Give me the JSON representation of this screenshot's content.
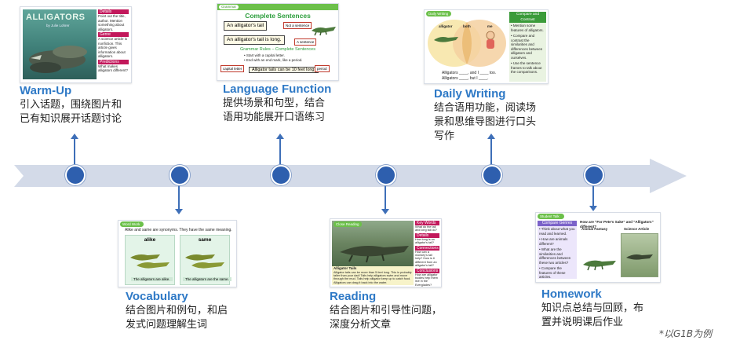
{
  "note": "*以G1B为例",
  "stages": {
    "warmup": {
      "title": "Warm-Up",
      "desc_line1": "引入话题，围绕图片和",
      "desc_line2": "已有知识展开话题讨论",
      "book_title": "ALLIGATORS",
      "book_author": "by Julie Lohrer",
      "side": [
        {
          "tag": "Details",
          "text": "Point out the title, author. Mention something about alligators."
        },
        {
          "tag": "Genre",
          "text": "A science article is nonfiction. This article gives information about alligators."
        },
        {
          "tag": "Predictions",
          "text": "What makes alligators different?"
        }
      ]
    },
    "vocabulary": {
      "title": "Vocabulary",
      "desc_line1": "结合图片和例句，和启",
      "desc_line2": "发式问题理解生词",
      "pill": "Word Work",
      "sentence": "Alike and same are synonyms. They have the same meaning.",
      "card1_word": "alike",
      "card2_word": "same",
      "caption": "The alligators are alike.",
      "caption2": "The alligators are the same."
    },
    "language": {
      "title": "Language Function",
      "desc_line1": "提供场景和句型，结合",
      "desc_line2": "语用功能展开口语练习",
      "pill": "Grammar",
      "heading": "Complete Sentences",
      "s1": "An alligator's tail",
      "s1_tag": "Not a sentence",
      "s2": "An alligator's tail is long.",
      "s2_tag": "A sentence",
      "rules_title": "Grammar Rules – Complete Sentences",
      "rule1": "Start with a capital letter.",
      "rule2": "End with an end mark, like a period.",
      "ex_left": "capital letter",
      "ex_sentence": "Alligator tails can be 10 feet long.",
      "ex_right": "period"
    },
    "reading": {
      "title": "Reading",
      "desc_line1": "结合图片和引导性问题，",
      "desc_line2": "深度分析文章",
      "pill": "Close Reading",
      "passage_title": "Alligator Tails",
      "passage": "Alligator tails can be more than 5 feet long. This is probably taller than your dad! Tails help alligators swim and move through the mud. Tails help alligator keep up to catch food. Alligators can drag it back into the water.",
      "side": [
        {
          "tag": "Key Words",
          "text": "What do the tail and long tail do?"
        },
        {
          "tag": "Details",
          "text": "How long is an alligator's tail?"
        },
        {
          "tag": "Connections",
          "text": "How can a monkey's tail help? How is it different from an alligator's tail?"
        },
        {
          "tag": "Conclusions",
          "text": "How are alligator bodies help them live in the Everglades?"
        }
      ]
    },
    "writing": {
      "title": "Daily Writing",
      "desc_line1": "结合语用功能，阅读场",
      "desc_line2": "景和思维导图进行口头",
      "desc_line3": "写作",
      "pill": "Daily Writing",
      "left_label": "alligator",
      "mid_label": "both",
      "right_label": "me",
      "frame1": "Alligators ____, and I ____ too.",
      "frame2": "Alligators ____, but I ____.",
      "panel_title": "Compare and Contrast",
      "panel_items": [
        "Mention some features of alligators.",
        "Compare and contrast the similarities and differences between alligators and ourselves.",
        "Use the sentence frames to talk about the comparisons."
      ]
    },
    "homework": {
      "title": "Homework",
      "desc_line1": "知识点总结与回顾，布",
      "desc_line2": "置并说明课后作业",
      "pill": "Student Talk",
      "question": "How are \"For Pete's Sake\" and \"Alligators\" different?",
      "panel_title": "Compare Genres",
      "panel_items": [
        "Think about what you read and learned.",
        "How are animals different?",
        "What are the similarities and differences between these two articles?",
        "Compare the features of these articles."
      ],
      "col1": "Animal Fantasy",
      "col2": "Science Article"
    }
  },
  "colors": {
    "accent_blue": "#2e79c6",
    "node_blue": "#2e5fae",
    "arrow": "#d3dae8",
    "green": "#6cc04a",
    "magenta": "#c2185b",
    "purple": "#7b62c9"
  }
}
